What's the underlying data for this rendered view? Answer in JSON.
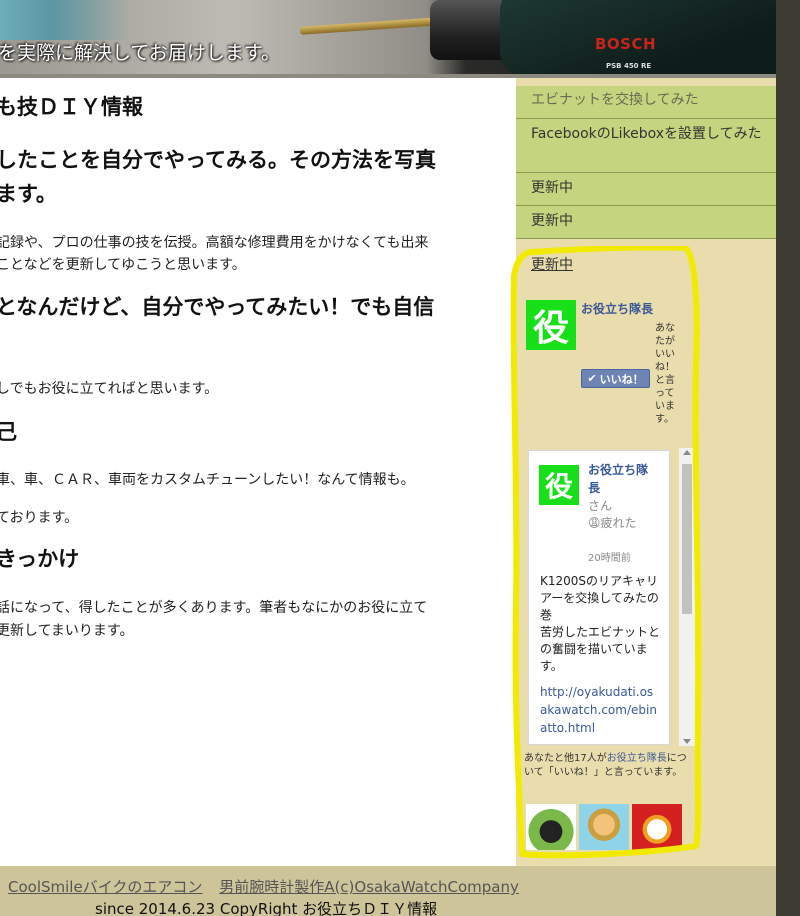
{
  "header": {
    "tagline": "を実際に解決してお届けします。",
    "brand": "BOSCH",
    "model": "PSB 450 RE"
  },
  "main": {
    "sections": [
      {
        "heading": "も技ＤＩＹ情報"
      },
      {
        "heading_line1": "したことを自分でやってみる。その方法を写真",
        "heading_line2": "ます。"
      },
      {
        "text_line1": "記録や、プロの仕事の技を伝授。高額な修理費用をかけなくても出来",
        "text_line2": "ことなどを更新してゆこうと思います。"
      },
      {
        "heading": "となんだけど、自分でやってみたい！でも自信"
      },
      {
        "text": "しでもお役に立てればと思います。"
      },
      {
        "heading": "己"
      },
      {
        "text": "車、車、ＣＡＲ、車両をカスタムチューンしたい！なんて情報も。"
      },
      {
        "text": "ております。"
      },
      {
        "heading": "きっかけ"
      },
      {
        "text_line1": "話になって、得したことが多くあります。筆者もなにかのお役に立て",
        "text_line2": "更新してまいります。"
      }
    ]
  },
  "sidebar": {
    "items": [
      "エビナットを交換してみた",
      "FacebookのLikeboxを設置してみた",
      "更新中",
      "更新中"
    ],
    "plain_link": "更新中",
    "facebook": {
      "logo_char": "役",
      "page_name": "お役立ち隊長",
      "like_label": "いいね！",
      "like_text": "あなたがいいね！と言っています。",
      "post": {
        "author": "お役立ち隊長",
        "san": "さん",
        "status": "疲れた",
        "time": "20時間前",
        "body": "K1200Sのリアキャリアーを交換してみたの巻\n苦労したエビナットとの奮闘を描いています。",
        "url": "http://oyakudati.osakawatch.com/ebinatto.html"
      },
      "footer_prefix": "あなたと他17人が",
      "footer_link": "お役立ち隊長",
      "footer_suffix": "について「いいね！」と言っています。"
    }
  },
  "footer": {
    "link1": "CoolSmileバイクのエアコン",
    "link2": "男前腕時計製作A(c)OsakaWatchCompany",
    "copyright": "since 2014.6.23 CopyRight お役立ちＤＩＹ情報"
  },
  "colors": {
    "sidebar_bg": "#e9dcad",
    "menu_bg": "#c5d47e",
    "footer_bg": "#cdc49a",
    "facebook_blue": "#3b5998",
    "highlight_yellow": "#f2ea00"
  }
}
